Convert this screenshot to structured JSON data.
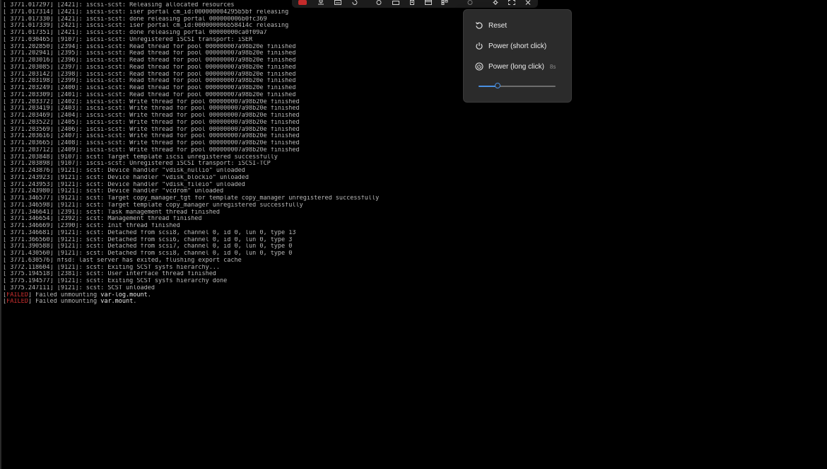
{
  "console": {
    "lines": [
      "[ 3771.017297] [2421]: iscsi-scst: Releasing allocated resources",
      "[ 3771.017314] [2421]: iscsi-scst: iser portal cm_id:000000004295b5bf releasing",
      "[ 3771.017330] [2421]: iscsi-scst: done releasing portal 000000006b0fc369",
      "[ 3771.017339] [2421]: iscsi-scst: iser portal cm_id:000000006b58414c releasing",
      "[ 3771.017351] [2421]: iscsi-scst: done releasing portal 00000000ca0f09a7",
      "[ 3771.030465] [9107]: iscsi-scst: Unregistered iSCSI transport: iSER",
      "[ 3771.202850] [2394]: iscsi-scst: Read thread for pool 000000007a98b20e finished",
      "[ 3771.202941] [2395]: iscsi-scst: Read thread for pool 000000007a98b20e finished",
      "[ 3771.203016] [2396]: iscsi-scst: Read thread for pool 000000007a98b20e finished",
      "[ 3771.203085] [2397]: iscsi-scst: Read thread for pool 000000007a98b20e finished",
      "[ 3771.203142] [2398]: iscsi-scst: Read thread for pool 000000007a98b20e finished",
      "[ 3771.203198] [2399]: iscsi-scst: Read thread for pool 000000007a98b20e finished",
      "[ 3771.203249] [2400]: iscsi-scst: Read thread for pool 000000007a98b20e finished",
      "[ 3771.203309] [2401]: iscsi-scst: Read thread for pool 000000007a98b20e finished",
      "[ 3771.203372] [2402]: iscsi-scst: Write thread for pool 000000007a98b20e finished",
      "[ 3771.203419] [2403]: iscsi-scst: Write thread for pool 000000007a98b20e finished",
      "[ 3771.203469] [2404]: iscsi-scst: Write thread for pool 000000007a98b20e finished",
      "[ 3771.203522] [2405]: iscsi-scst: Write thread for pool 000000007a98b20e finished",
      "[ 3771.203569] [2406]: iscsi-scst: Write thread for pool 000000007a98b20e finished",
      "[ 3771.203616] [2407]: iscsi-scst: Write thread for pool 000000007a98b20e finished",
      "[ 3771.203665] [2408]: iscsi-scst: Write thread for pool 000000007a98b20e finished",
      "[ 3771.203712] [2409]: iscsi-scst: Write thread for pool 000000007a98b20e finished",
      "[ 3771.203848] [9107]: scst: Target template iscsi unregistered successfully",
      "[ 3771.203898] [9107]: iscsi-scst: Unregistered iSCSI transport: iSCSI-TCP",
      "[ 3771.243876] [9121]: scst: Device handler \"vdisk_nullio\" unloaded",
      "[ 3771.243923] [9121]: scst: Device handler \"vdisk_blockio\" unloaded",
      "[ 3771.243953] [9121]: scst: Device handler \"vdisk_fileio\" unloaded",
      "[ 3771.243980] [9121]: scst: Device handler \"vcdrom\" unloaded",
      "[ 3771.346577] [9121]: scst: Target copy_manager_tgt for template copy_manager unregistered successfully",
      "[ 3771.346598] [9121]: scst: Target template copy_manager unregistered successfully",
      "[ 3771.346641] [2391]: scst: Task management thread finished",
      "[ 3771.346654] [2392]: scst: Management thread finished",
      "[ 3771.346669] [2390]: scst: Init thread finished",
      "[ 3771.346681] [9121]: scst: Detached from scsi8, channel 0, id 0, lun 0, type 13",
      "[ 3771.366560] [9121]: scst: Detached from scsi6, channel 0, id 0, lun 0, type 3",
      "[ 3771.390588] [9121]: scst: Detached from scsi7, channel 0, id 0, lun 0, type 0",
      "[ 3771.430560] [9121]: scst: Detached from scsi8, channel 0, id 0, lun 0, type 0",
      "[ 3771.630576] nfsd: last server has exited, flushing export cache",
      "[ 3772.118604] [9121]: scst: Exiting SCST sysfs hierarchy...",
      "[ 3775.194518] [2381]: scst: User interface thread finished",
      "[ 3775.194577] [9121]: scst: Exiting SCST sysfs hierarchy done",
      "[ 3775.247111] [9121]: scst: SCST unloaded"
    ],
    "failed_lines": [
      {
        "tag": "FAILED",
        "text": " Failed unmounting ",
        "unit": "var-log.mount",
        "end": "."
      },
      {
        "tag": "FAILED",
        "text": " Failed unmounting ",
        "unit": "var.mount",
        "end": "."
      }
    ]
  },
  "toolbar": {
    "icons": [
      "record-stop-icon",
      "network-icon",
      "keyboard-icon",
      "clipboard-icon",
      "refresh-icon",
      "clock-icon",
      "folder-icon",
      "usb-icon",
      "window-icon",
      "grid-icon",
      "circle-icon",
      "gear-icon",
      "fullscreen-icon",
      "close-icon"
    ]
  },
  "power_menu": {
    "reset_label": "Reset",
    "power_short_label": "Power (short click)",
    "power_long_label": "Power (long click)",
    "power_long_hint": "8s",
    "slider_value_fraction": 0.25,
    "accent_color": "#4a90e2"
  }
}
